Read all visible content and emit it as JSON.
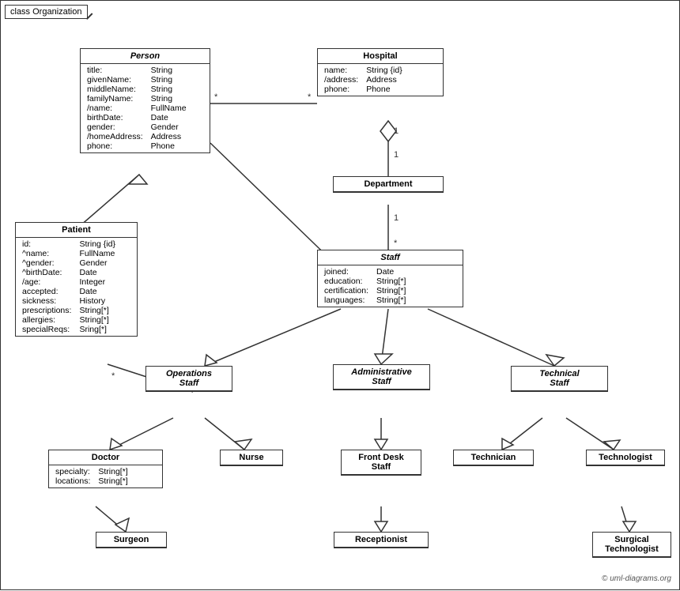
{
  "diagram": {
    "title": "class Organization",
    "copyright": "© uml-diagrams.org"
  },
  "classes": {
    "person": {
      "name": "Person",
      "italic": true,
      "attrs": [
        [
          "title:",
          "String"
        ],
        [
          "givenName:",
          "String"
        ],
        [
          "middleName:",
          "String"
        ],
        [
          "familyName:",
          "String"
        ],
        [
          "/name:",
          "FullName"
        ],
        [
          "birthDate:",
          "Date"
        ],
        [
          "gender:",
          "Gender"
        ],
        [
          "/homeAddress:",
          "Address"
        ],
        [
          "phone:",
          "Phone"
        ]
      ]
    },
    "hospital": {
      "name": "Hospital",
      "italic": false,
      "attrs": [
        [
          "name:",
          "String {id}"
        ],
        [
          "/address:",
          "Address"
        ],
        [
          "phone:",
          "Phone"
        ]
      ]
    },
    "patient": {
      "name": "Patient",
      "italic": false,
      "attrs": [
        [
          "id:",
          "String {id}"
        ],
        [
          "^name:",
          "FullName"
        ],
        [
          "^gender:",
          "Gender"
        ],
        [
          "^birthDate:",
          "Date"
        ],
        [
          "/age:",
          "Integer"
        ],
        [
          "accepted:",
          "Date"
        ],
        [
          "sickness:",
          "History"
        ],
        [
          "prescriptions:",
          "String[*]"
        ],
        [
          "allergies:",
          "String[*]"
        ],
        [
          "specialReqs:",
          "Sring[*]"
        ]
      ]
    },
    "department": {
      "name": "Department",
      "italic": false,
      "attrs": []
    },
    "staff": {
      "name": "Staff",
      "italic": true,
      "attrs": [
        [
          "joined:",
          "Date"
        ],
        [
          "education:",
          "String[*]"
        ],
        [
          "certification:",
          "String[*]"
        ],
        [
          "languages:",
          "String[*]"
        ]
      ]
    },
    "operations_staff": {
      "name": "Operations Staff",
      "italic": true,
      "attrs": []
    },
    "administrative_staff": {
      "name": "Administrative Staff",
      "italic": true,
      "attrs": []
    },
    "technical_staff": {
      "name": "Technical Staff",
      "italic": true,
      "attrs": []
    },
    "doctor": {
      "name": "Doctor",
      "italic": false,
      "attrs": [
        [
          "specialty:",
          "String[*]"
        ],
        [
          "locations:",
          "String[*]"
        ]
      ]
    },
    "nurse": {
      "name": "Nurse",
      "italic": false,
      "attrs": []
    },
    "front_desk_staff": {
      "name": "Front Desk Staff",
      "italic": false,
      "attrs": []
    },
    "technician": {
      "name": "Technician",
      "italic": false,
      "attrs": []
    },
    "technologist": {
      "name": "Technologist",
      "italic": false,
      "attrs": []
    },
    "surgeon": {
      "name": "Surgeon",
      "italic": false,
      "attrs": []
    },
    "receptionist": {
      "name": "Receptionist",
      "italic": false,
      "attrs": []
    },
    "surgical_technologist": {
      "name": "Surgical Technologist",
      "italic": false,
      "attrs": []
    }
  }
}
